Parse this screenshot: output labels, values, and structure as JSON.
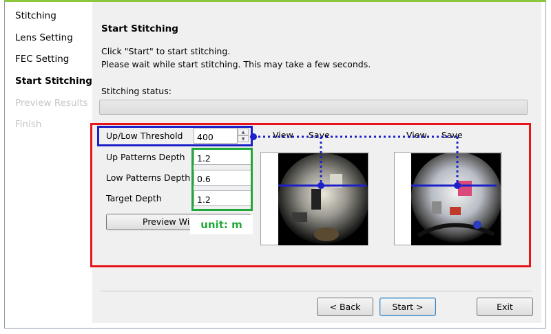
{
  "sidebar": {
    "items": [
      {
        "label": "Stitching",
        "state": "normal"
      },
      {
        "label": "Lens Setting",
        "state": "normal"
      },
      {
        "label": "FEC Setting",
        "state": "normal"
      },
      {
        "label": "Start Stitching",
        "state": "active"
      },
      {
        "label": "Preview Results",
        "state": "disabled"
      },
      {
        "label": "Finish",
        "state": "disabled"
      }
    ]
  },
  "main": {
    "title": "Start Stitching",
    "description_line1": "Click \"Start\" to start stitching.",
    "description_line2": "Please wait while start stitching. This may take a few seconds.",
    "status_label": "Stitching status:",
    "progress": 0
  },
  "fields": {
    "threshold_label": "Up/Low Threshold",
    "threshold_value": "400",
    "up_depth_label": "Up Patterns Depth",
    "up_depth_value": "1.2",
    "low_depth_label": "Low Patterns Depth",
    "low_depth_value": "0.6",
    "target_depth_label": "Target Depth",
    "target_depth_value": "1.2"
  },
  "preview_button": "Preview Window",
  "annotation": {
    "unit": "unit: m"
  },
  "previews": {
    "left": {
      "view": "View",
      "save": "Save"
    },
    "right": {
      "view": "View",
      "save": "Save"
    }
  },
  "footer": {
    "back": "< Back",
    "start": "Start >",
    "exit": "Exit"
  },
  "colors": {
    "accent_top": "#8cc63f",
    "highlight_red": "#e8141a",
    "highlight_blue": "#1b20c8",
    "highlight_green": "#22a83a"
  }
}
